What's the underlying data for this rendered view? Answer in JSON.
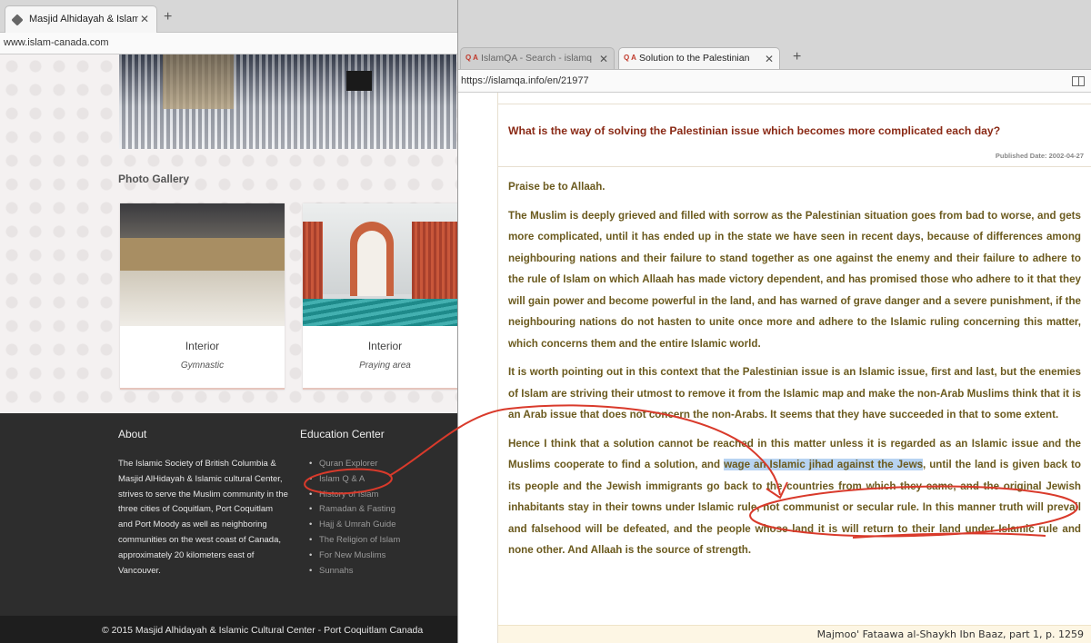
{
  "left_window": {
    "tab_title": "Masjid Alhidayah & Islamic Cu",
    "url": "www.islam-canada.com",
    "gallery_title": "Photo Gallery",
    "cards": [
      {
        "title": "Interior",
        "subtitle": "Gymnastic"
      },
      {
        "title": "Interior",
        "subtitle": "Praying area"
      }
    ],
    "footer": {
      "about_heading": "About",
      "about_text": "The Islamic Society of British Columbia & Masjid AlHidayah & Islamic cultural Center, strives to serve the Muslim community in the three cities of Coquitlam, Port Coquitlam and Port Moody as well as neighboring communities on the west coast of Canada, approximately 20 kilometers east of Vancouver.",
      "edu_heading": "Education Center",
      "edu_links": [
        "Quran Explorer",
        "Islam Q & A",
        "History of Islam",
        "Ramadan & Fasting",
        "Hajj & Umrah Guide",
        "The Religion of Islam",
        "For New Muslims",
        "Sunnahs"
      ],
      "copyright": "© 2015 Masjid Alhidayah & Islamic Cultural Center - Port Coquitlam Canada"
    }
  },
  "right_window": {
    "tabs": [
      {
        "icon": "Q A",
        "title": "IslamQA - Search - islamqa.in"
      },
      {
        "icon": "Q A",
        "title": "Solution to the Palestinian iss"
      }
    ],
    "url": "https://islamqa.info/en/21977",
    "question": "What is the way of solving the Palestinian issue which becomes more complicated each day?",
    "published": "Published Date: 2002-04-27",
    "paragraphs": {
      "p1": "Praise be to Allaah.",
      "p2": "The Muslim is deeply grieved and filled with sorrow as the Palestinian situation goes from bad to worse, and gets more complicated, until it has ended up in the state we have seen in recent days, because of differences among neighbouring nations and their failure to stand together as one against the enemy and their failure to adhere to the rule of Islam on which Allaah has made victory dependent, and has promised those who adhere to it that they will gain power and become powerful in the land, and has warned of grave danger and a severe punishment, if the neighbouring nations do not hasten to unite once more and adhere to the Islamic ruling concerning this matter,  which concerns them and the entire Islamic world.",
      "p3": "It is worth pointing out in this context that the Palestinian issue is an Islamic issue, first and last, but the enemies of Islam are striving their utmost to remove it from the Islamic map and make the non-Arab Muslims think that it is an Arab issue that does not concern the non-Arabs. It seems that they have succeeded in that to some extent.",
      "p4_before": "Hence I think that a solution cannot be reached in this matter unless it is regarded as an Islamic issue and the Muslims cooperate to find a solution, and ",
      "p4_highlight": "wage an Islamic jihad against the Jews",
      "p4_after": ", until the land is given back to its people and the Jewish immigrants go back to the countries from which they came, and the original Jewish inhabitants stay in their towns under Islamic rule, not communist or secular rule. In this manner truth will prevail and falsehood will be defeated, and the people whose land it is will return to their land under Islamic rule and none other. And Allaah is the source of strength."
    },
    "source": "Majmoo' Fataawa al-Shaykh Ibn Baaz, part 1, p. 1259"
  },
  "colors": {
    "annotation": "#d93a2b",
    "question": "#8a2a16",
    "answer_text": "#6b5a1e",
    "highlight": "#b7d3f2"
  }
}
